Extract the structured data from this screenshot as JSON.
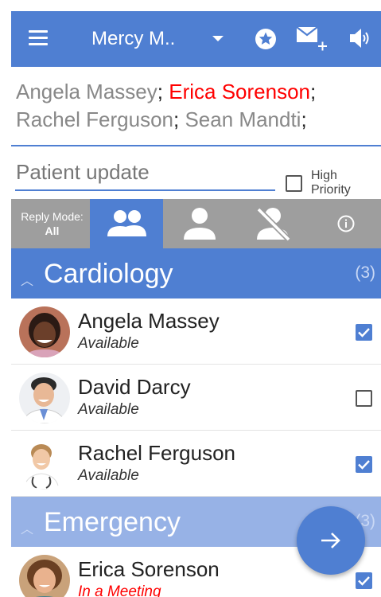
{
  "appbar": {
    "title": "Mercy M..",
    "menu_icon": "hamburger-menu-icon",
    "dropdown_icon": "caret-down-icon",
    "favorites_icon": "star-circle-icon",
    "compose_icon": "mail-plus-icon",
    "sound_icon": "speaker-icon"
  },
  "recipients": {
    "list": [
      {
        "name": "Angela Massey",
        "highlight": false
      },
      {
        "name": "Erica Sorenson",
        "highlight": true
      },
      {
        "name": "Rachel Ferguson",
        "highlight": false
      },
      {
        "name": "Sean Mandti",
        "highlight": false
      }
    ],
    "separator": ";"
  },
  "subject": {
    "value": "Patient update",
    "high_priority_label_1": "High",
    "high_priority_label_2": "Priority",
    "high_priority_checked": false
  },
  "reply_mode": {
    "label": "Reply Mode:",
    "value": "All",
    "segments": [
      {
        "icon": "group-icon",
        "active": true
      },
      {
        "icon": "person-icon",
        "active": false
      },
      {
        "icon": "person-off-icon",
        "active": false
      },
      {
        "icon": "info-icon",
        "active": false
      }
    ]
  },
  "groups": [
    {
      "name": "Cardiology",
      "count": "(3)",
      "members": [
        {
          "name": "Angela Massey",
          "status": "Available",
          "checked": true
        },
        {
          "name": "David Darcy",
          "status": "Available",
          "checked": false
        },
        {
          "name": "Rachel Ferguson",
          "status": "Available",
          "checked": true
        }
      ]
    },
    {
      "name": "Emergency",
      "count": "(3)",
      "members": [
        {
          "name": "Erica Sorenson",
          "status": "In a Meeting",
          "checked": true
        }
      ]
    }
  ],
  "fab": {
    "icon": "arrow-right-icon"
  },
  "colors": {
    "accent": "#4f7fd2",
    "accent_light": "#97b2e6",
    "alert": "#ff0000",
    "mode_bar": "#9e9e9e"
  }
}
